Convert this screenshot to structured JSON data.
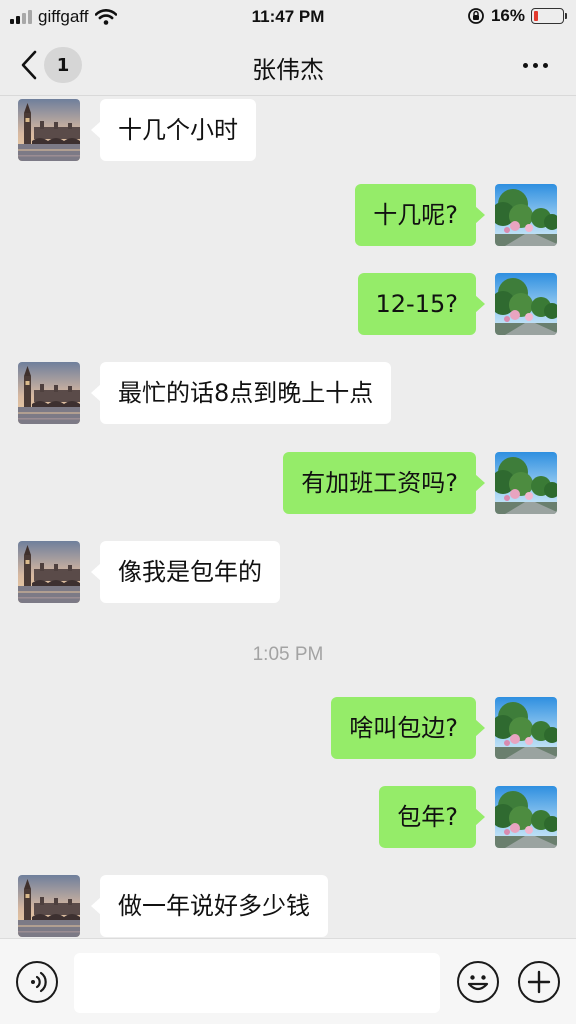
{
  "status_bar": {
    "carrier": "giffgaff",
    "time": "11:47 PM",
    "battery_percent": "16%",
    "battery_level": 0.16,
    "battery_color": "#e33b2f",
    "icons": [
      "cellular-signal-icon",
      "wifi-icon",
      "orientation-lock-icon",
      "battery-icon"
    ]
  },
  "nav": {
    "unread_count": "1",
    "title": "张伟杰",
    "icons": [
      "back-chevron-icon",
      "more-icon"
    ]
  },
  "chat": {
    "incoming_bubble_color": "#ffffff",
    "outgoing_bubble_color": "#95ec69",
    "messages": [
      {
        "side": "in",
        "text": "十几个小时"
      },
      {
        "side": "out",
        "text": "十几呢?"
      },
      {
        "side": "out",
        "text": "12-15?"
      },
      {
        "side": "in",
        "text": "最忙的话8点到晚上十点"
      },
      {
        "side": "out",
        "text": "有加班工资吗?"
      },
      {
        "side": "in",
        "text": "像我是包年的"
      },
      {
        "side": "out",
        "text": "啥叫包边?"
      },
      {
        "side": "out",
        "text": "包年?"
      },
      {
        "side": "in",
        "text": "做一年说好多少钱"
      }
    ],
    "timestamp": "1:05 PM"
  },
  "input_bar": {
    "icons": [
      "voice-icon",
      "emoji-icon",
      "plus-icon"
    ]
  }
}
